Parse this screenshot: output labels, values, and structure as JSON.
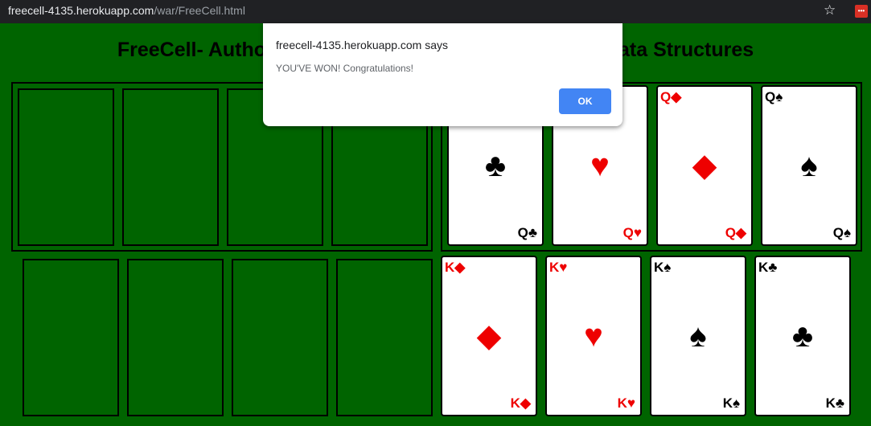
{
  "browser": {
    "url_host": "freecell-4135.herokuapp.com",
    "url_path": "/war/FreeCell.html",
    "star_icon": "star-icon",
    "extension_icon": "extension-icon",
    "extension_label": "•••"
  },
  "page": {
    "title": "FreeCell- Authors: ... Data Structures",
    "title_left": "FreeCell- Autho",
    "title_right": "ata Structures"
  },
  "foundations": [
    {
      "rank": "Q",
      "suit": "♣",
      "color": "black"
    },
    {
      "rank": "Q",
      "suit": "♥",
      "color": "red"
    },
    {
      "rank": "Q",
      "suit": "◆",
      "color": "red"
    },
    {
      "rank": "Q",
      "suit": "♠",
      "color": "black"
    }
  ],
  "tableau": [
    {
      "rank": "K",
      "suit": "◆",
      "color": "red"
    },
    {
      "rank": "K",
      "suit": "♥",
      "color": "red"
    },
    {
      "rank": "K",
      "suit": "♠",
      "color": "black"
    },
    {
      "rank": "K",
      "suit": "♣",
      "color": "black"
    }
  ],
  "dialog": {
    "title": "freecell-4135.herokuapp.com says",
    "message": "YOU'VE WON! Congratulations!",
    "ok_label": "OK"
  },
  "colors": {
    "felt": "#006400",
    "red_suit": "#ee0000",
    "button_blue": "#4285f4"
  }
}
